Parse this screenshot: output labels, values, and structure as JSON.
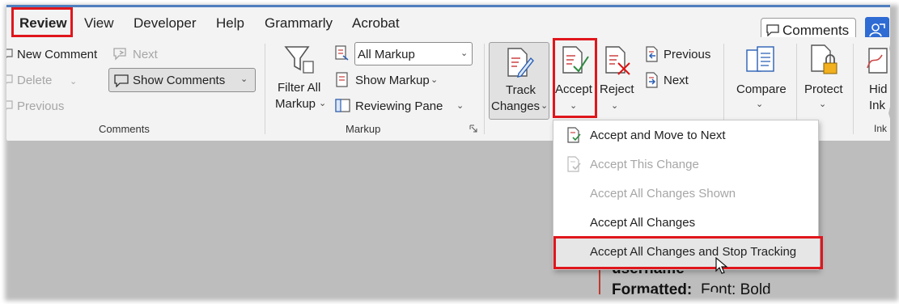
{
  "tabs": [
    {
      "label": "Review",
      "active": true
    },
    {
      "label": "View"
    },
    {
      "label": "Developer"
    },
    {
      "label": "Help"
    },
    {
      "label": "Grammarly"
    },
    {
      "label": "Acrobat"
    }
  ],
  "comments_button": {
    "label": "Comments",
    "icon": "comment-icon"
  },
  "share_button": {
    "icon": "share-icon"
  },
  "comments_group": {
    "label": "Comments",
    "new_comment": "New Comment",
    "next": "Next",
    "delete": "Delete",
    "show_comments": "Show Comments",
    "previous": "Previous"
  },
  "markup_group": {
    "label": "Markup",
    "filter_all": "Filter All",
    "markup": "Markup",
    "markup_select": "All Markup",
    "show_markup": "Show Markup",
    "reviewing_pane": "Reviewing Pane"
  },
  "tracking_group": {
    "track": "Track",
    "changes": "Changes",
    "accept": "Accept",
    "reject": "Reject",
    "previous": "Previous",
    "next": "Next"
  },
  "compare_group": {
    "compare": "Compare"
  },
  "protect_group": {
    "protect": "Protect"
  },
  "ink_group": {
    "hide": "Hid",
    "ink": "Ink",
    "label": "Ink"
  },
  "accept_menu": {
    "items": [
      {
        "label": "Accept and Move to Next",
        "enabled": true
      },
      {
        "label": "Accept This Change",
        "enabled": false
      },
      {
        "label": "Accept All Changes Shown",
        "enabled": false
      },
      {
        "label": "Accept All Changes",
        "enabled": true
      },
      {
        "label": "Accept All Changes and Stop Tracking",
        "enabled": true,
        "highlighted": true
      }
    ]
  },
  "document": {
    "line1": "username",
    "formatted_label": "Formatted:",
    "formatted_value": "Font: Bold"
  },
  "colors": {
    "highlight_box": "#e0161c",
    "accent": "#2e6bd3",
    "ribbon_bg": "#f3f3f3"
  }
}
